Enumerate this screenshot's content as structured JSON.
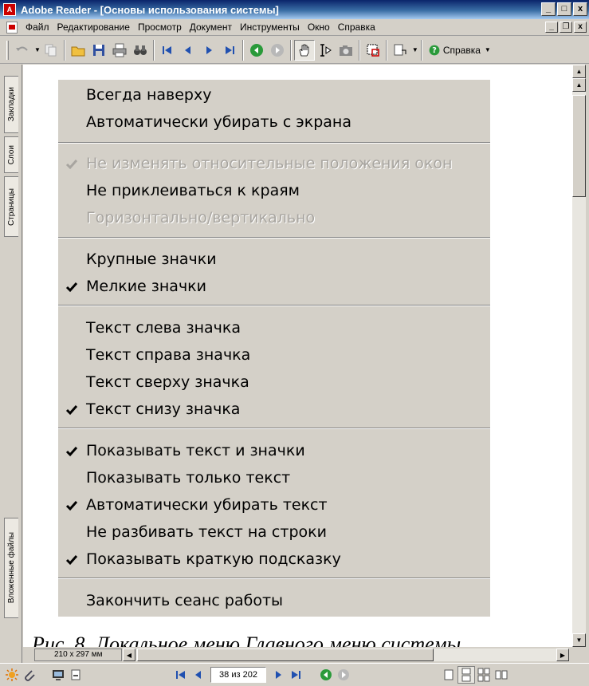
{
  "window": {
    "app_icon": "adobe-icon",
    "title": "Adobe Reader - [Основы использования системы]",
    "minimize": "_",
    "maximize": "□",
    "close": "x"
  },
  "menubar": {
    "items": [
      "Файл",
      "Редактирование",
      "Просмотр",
      "Документ",
      "Инструменты",
      "Окно",
      "Справка"
    ]
  },
  "toolbar": {
    "help_label": "Справка"
  },
  "nav_tabs": [
    "Закладки",
    "Слои",
    "Страницы",
    "Вложенные файлы"
  ],
  "document": {
    "menu_items": [
      {
        "label": "Всегда наверху",
        "checked": false,
        "disabled": false
      },
      {
        "label": "Автоматически убирать с экрана",
        "checked": false,
        "disabled": false
      },
      {
        "label": "Не изменять относительные положения окон",
        "checked": true,
        "disabled": true
      },
      {
        "label": "Не приклеиваться к краям",
        "checked": false,
        "disabled": false
      },
      {
        "label": "Горизонтально/вертикально",
        "checked": false,
        "disabled": true
      },
      {
        "label": "Крупные значки",
        "checked": false,
        "disabled": false
      },
      {
        "label": "Мелкие значки",
        "checked": true,
        "disabled": false
      },
      {
        "label": "Текст слева значка",
        "checked": false,
        "disabled": false
      },
      {
        "label": "Текст справа значка",
        "checked": false,
        "disabled": false
      },
      {
        "label": "Текст сверху значка",
        "checked": false,
        "disabled": false
      },
      {
        "label": "Текст снизу значка",
        "checked": true,
        "disabled": false
      },
      {
        "label": "Показывать текст и значки",
        "checked": true,
        "disabled": false
      },
      {
        "label": "Показывать только текст",
        "checked": false,
        "disabled": false
      },
      {
        "label": "Автоматически убирать текст",
        "checked": true,
        "disabled": false
      },
      {
        "label": "Не разбивать текст на строки",
        "checked": false,
        "disabled": false
      },
      {
        "label": "Показывать краткую подсказку",
        "checked": true,
        "disabled": false
      },
      {
        "label": "Закончить сеанс работы",
        "checked": false,
        "disabled": false
      }
    ],
    "caption": "Рис. 8. Локальное меню Главного меню системы"
  },
  "statusbar": {
    "page_size": "210 x 297 мм",
    "page_indicator": "38 из 202"
  }
}
